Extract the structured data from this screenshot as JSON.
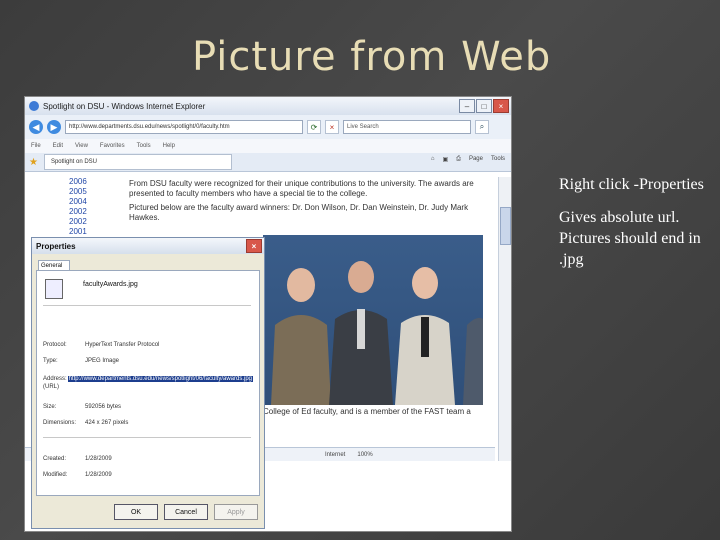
{
  "slide": {
    "title": "Picture from Web",
    "bullet_1": "Right click -Properties",
    "bullet_2": "Gives absolute url. Pictures should end in .jpg"
  },
  "browser": {
    "window_title": "Spotlight on DSU - Windows Internet Explorer",
    "address": "http://www.departments.dsu.edu/news/spotlight/0/faculty.htm",
    "search_placeholder": "Live Search",
    "menu": [
      "File",
      "Edit",
      "View",
      "Favorites",
      "Tools",
      "Help"
    ],
    "tab_label": "Spotlight on DSU",
    "commands": [
      "Page",
      "Tools"
    ],
    "status_internet": "Internet",
    "zoom": "100%"
  },
  "page": {
    "years": [
      "2006",
      "2005",
      "2004",
      "2002",
      "2002",
      "2001"
    ],
    "text_1": "From DSU faculty were recognized for their unique contributions to the university. The awards are presented to faculty members who have a special tie to the college.",
    "text_2": "Pictured below are the faculty award winners: Dr. Don Wilson, Dr. Dan Weinstein, Dr. Judy Mark Hawkes.",
    "caption": "College of Ed faculty, and is a member of the FAST team a"
  },
  "properties": {
    "title": "Properties",
    "tab": "General",
    "file_name": "facultyAwards.jpg",
    "protocol_label": "Protocol:",
    "protocol_value": "HyperText Transfer Protocol",
    "type_label": "Type:",
    "type_value": "JPEG Image",
    "address_label": "Address: (URL)",
    "address_value": "http://www.departments.dsu.edu/news/spotlight/06/faculty/awards.jpg",
    "size_label": "Size:",
    "size_value": "592056 bytes",
    "dimensions_label": "Dimensions:",
    "dimensions_value": "424 x 267 pixels",
    "created_label": "Created:",
    "created_value": "1/28/2009",
    "modified_label": "Modified:",
    "modified_value": "1/28/2009",
    "ok_label": "OK",
    "cancel_label": "Cancel",
    "apply_label": "Apply"
  },
  "colors": {
    "title_color": "#e8ddb5",
    "slide_bg": "#444444"
  }
}
